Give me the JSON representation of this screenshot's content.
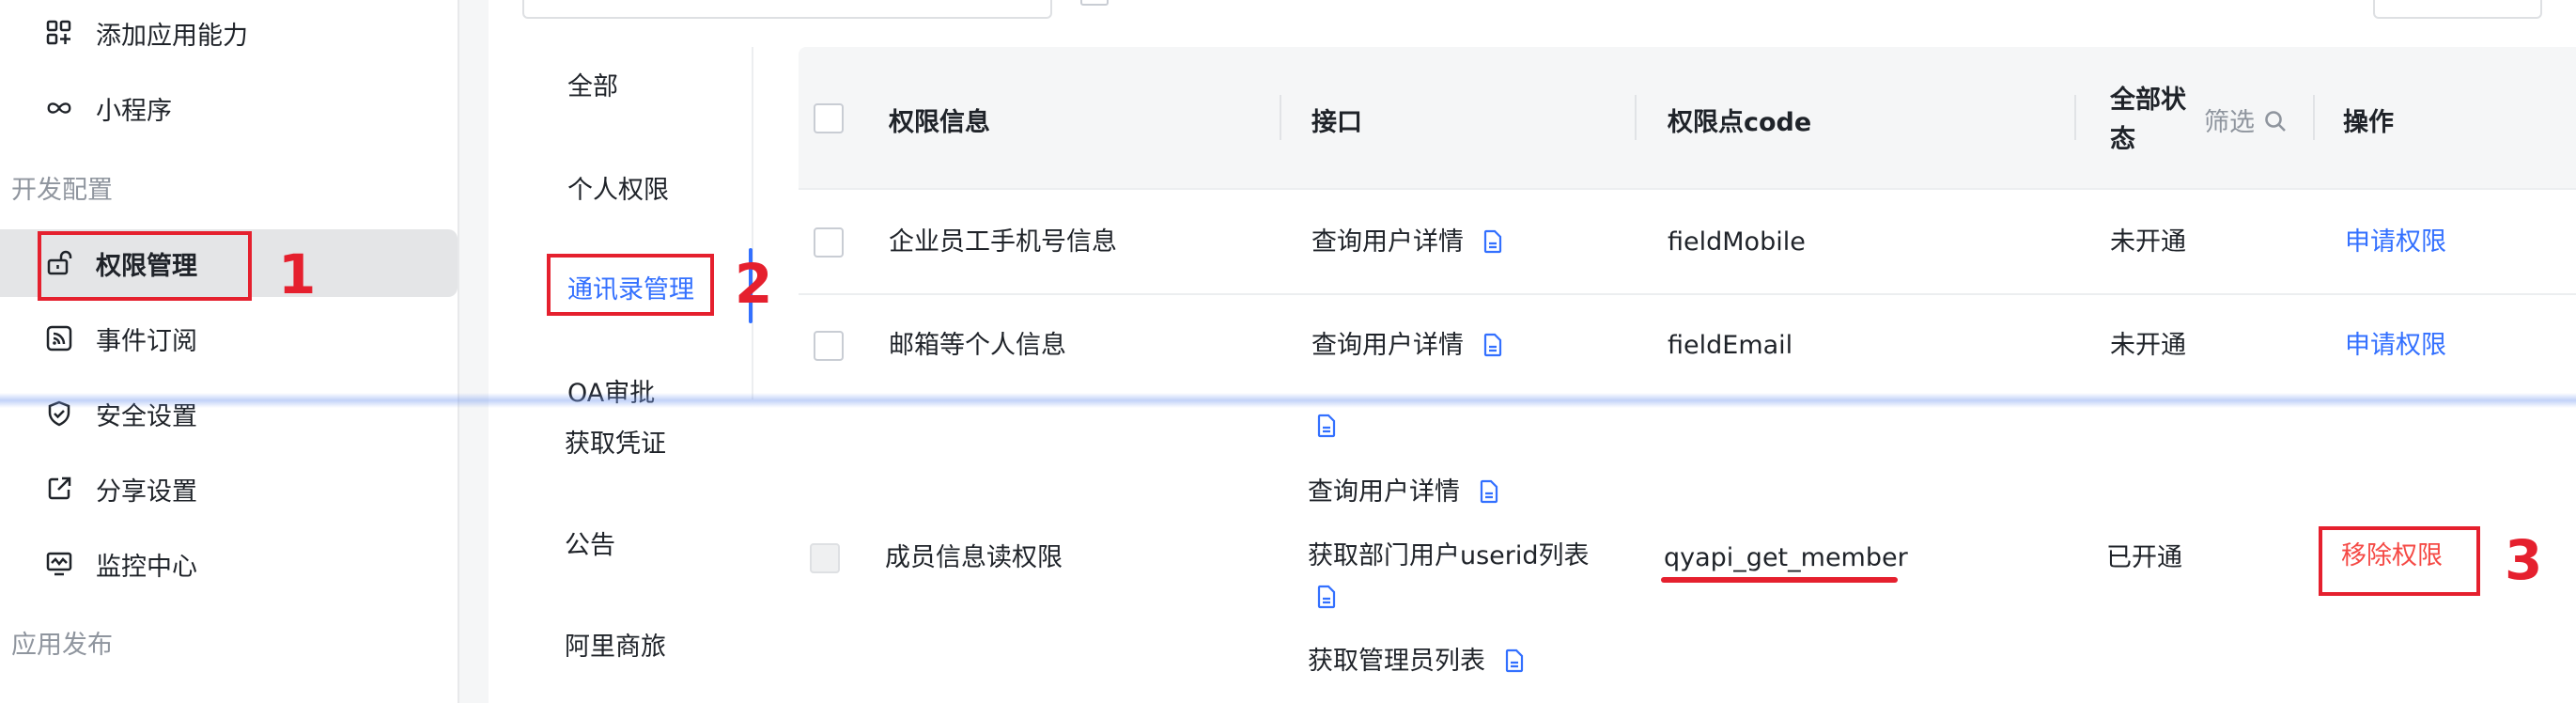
{
  "sidebar": {
    "items": [
      {
        "label": "添加应用能力",
        "icon": "grid-plus-icon"
      },
      {
        "label": "小程序",
        "icon": "link-loop-icon"
      },
      {
        "label": "权限管理",
        "icon": "unlock-icon"
      },
      {
        "label": "事件订阅",
        "icon": "rss-icon"
      },
      {
        "label": "安全设置",
        "icon": "shield-icon"
      },
      {
        "label": "分享设置",
        "icon": "share-icon"
      },
      {
        "label": "监控中心",
        "icon": "monitor-icon"
      }
    ],
    "sections": [
      "开发配置",
      "应用发布"
    ]
  },
  "categories": [
    "全部",
    "个人权限",
    "通讯录管理",
    "OA审批",
    "获取凭证",
    "公告",
    "阿里商旅"
  ],
  "table": {
    "headers": {
      "info": "权限信息",
      "api": "接口",
      "code": "权限点code",
      "status_line1": "全部状",
      "status_line2": "态",
      "filter": "筛选",
      "action": "操作"
    },
    "rows": [
      {
        "info": "企业员工手机号信息",
        "api": "查询用户详情",
        "code": "fieldMobile",
        "status": "未开通",
        "action": "申请权限"
      },
      {
        "info": "邮箱等个人信息",
        "api": "查询用户详情",
        "code": "fieldEmail",
        "status": "未开通",
        "action": "申请权限"
      },
      {
        "info": "成员信息读权限",
        "apis": [
          "查询用户详情",
          "获取部门用户userid列表",
          "获取管理员列表"
        ],
        "code": "qyapi_get_member",
        "status": "已开通",
        "action": "移除权限"
      }
    ]
  },
  "annotations": [
    "1",
    "2",
    "3"
  ],
  "colors": {
    "accent": "#3370ff",
    "danger": "#f54a45",
    "annotation": "#e5202e"
  }
}
